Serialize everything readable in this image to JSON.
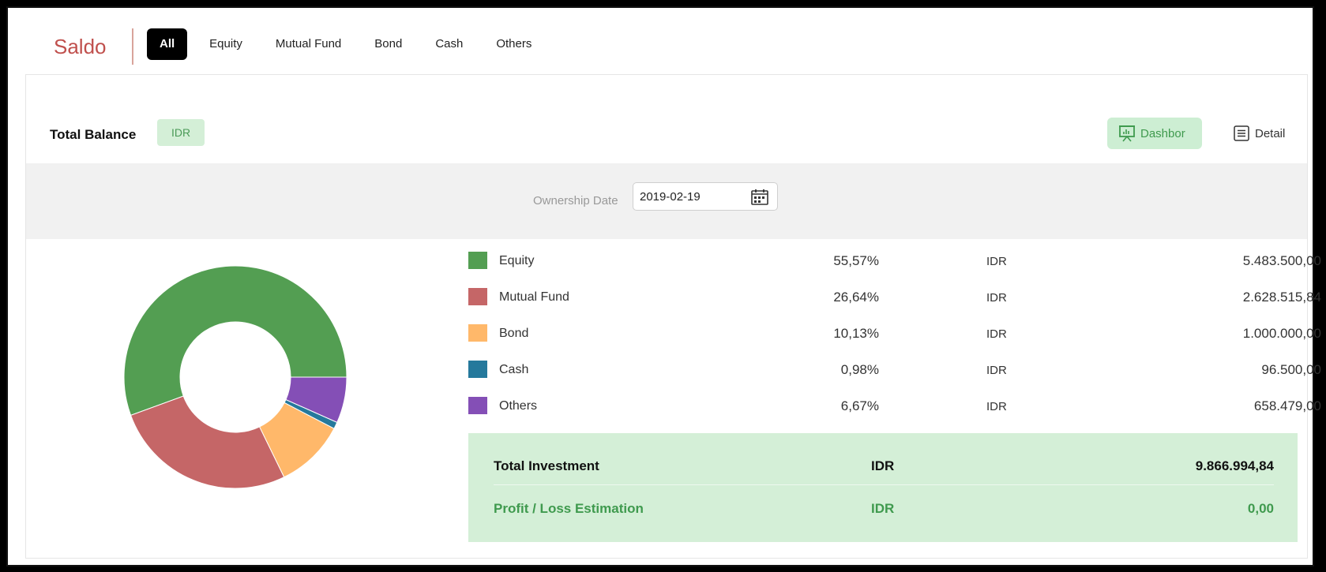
{
  "app": {
    "brand": "Saldo"
  },
  "tabs": [
    {
      "label": "All",
      "active": true
    },
    {
      "label": "Equity",
      "active": false
    },
    {
      "label": "Mutual Fund",
      "active": false
    },
    {
      "label": "Bond",
      "active": false
    },
    {
      "label": "Cash",
      "active": false
    },
    {
      "label": "Others",
      "active": false
    }
  ],
  "header": {
    "title": "Total Balance",
    "currency": "IDR",
    "views": {
      "dashboard": "Dashbor",
      "detail": "Detail"
    }
  },
  "filter": {
    "label": "Ownership Date",
    "value": "2019-02-19"
  },
  "holdings": [
    {
      "name": "Equity",
      "percent": "55,57%",
      "currency": "IDR",
      "amount": "5.483.500,00",
      "share": 55.57,
      "color": "#539e52"
    },
    {
      "name": "Mutual Fund",
      "percent": "26,64%",
      "currency": "IDR",
      "amount": "2.628.515,84",
      "share": 26.64,
      "color": "#c56667"
    },
    {
      "name": "Bond",
      "percent": "10,13%",
      "currency": "IDR",
      "amount": "1.000.000,00",
      "share": 10.13,
      "color": "#ffb86a"
    },
    {
      "name": "Cash",
      "percent": "0,98%",
      "currency": "IDR",
      "amount": "96.500,00",
      "share": 0.98,
      "color": "#25799c"
    },
    {
      "name": "Others",
      "percent": "6,67%",
      "currency": "IDR",
      "amount": "658.479,00",
      "share": 6.67,
      "color": "#844fb6"
    }
  ],
  "summary": {
    "total": {
      "label": "Total Investment",
      "currency": "IDR",
      "value": "9.866.994,84"
    },
    "profit": {
      "label": "Profit / Loss Estimation",
      "currency": "IDR",
      "value": "0,00"
    }
  },
  "chart_data": {
    "type": "pie",
    "categories": [
      "Equity",
      "Mutual Fund",
      "Bond",
      "Cash",
      "Others"
    ],
    "values": [
      55.57,
      26.64,
      10.13,
      0.98,
      6.67
    ],
    "colors": [
      "#539e52",
      "#c56667",
      "#ffb86a",
      "#25799c",
      "#844fb6"
    ]
  }
}
